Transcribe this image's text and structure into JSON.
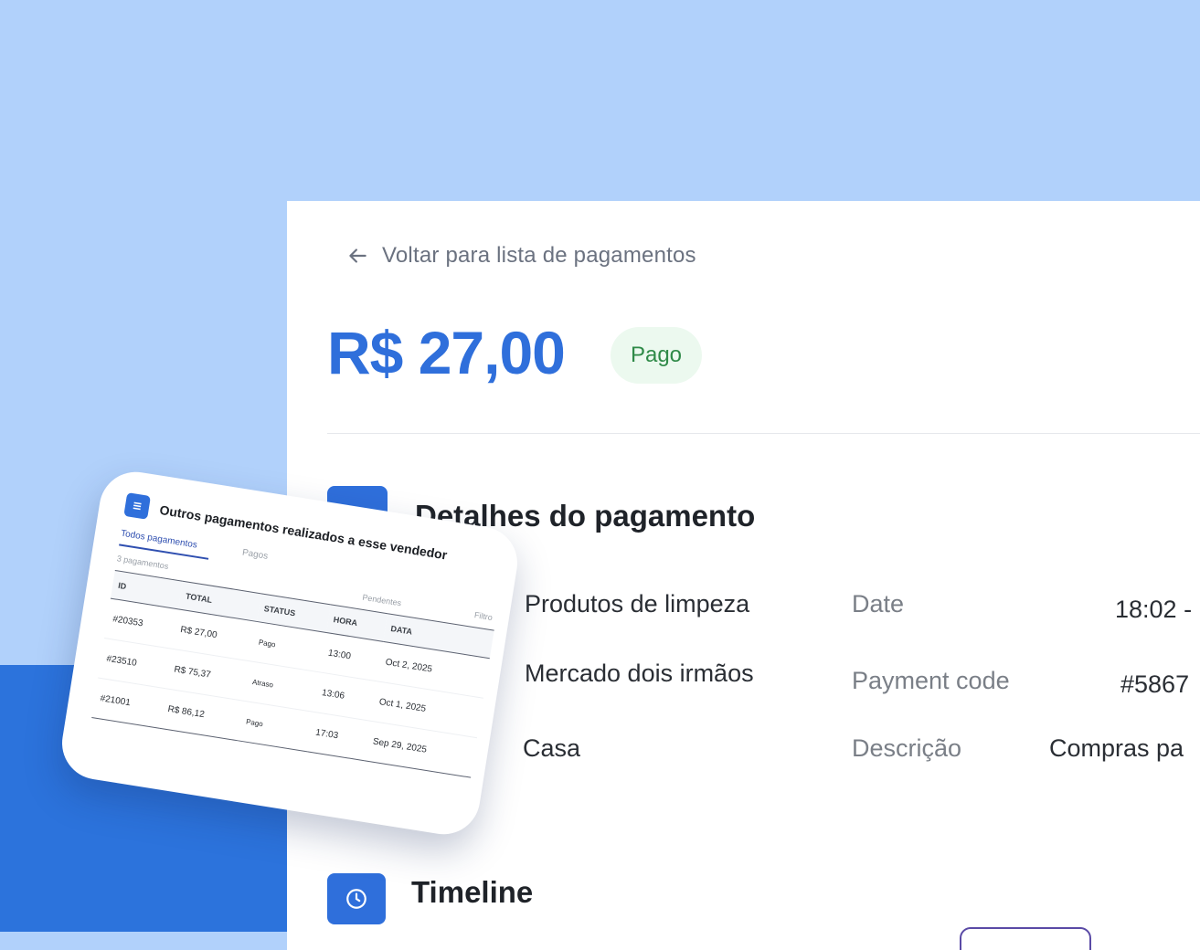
{
  "detail": {
    "back_label": "Voltar para lista de pagamentos",
    "amount": "R$ 27,00",
    "status_badge": "Pago",
    "section_title": "Detalhes do pagamento",
    "list_items": [
      "Produtos de limpeza",
      "Mercado dois irmãos",
      "Casa"
    ],
    "fields": [
      {
        "label": "Date",
        "value": "18:02 -"
      },
      {
        "label": "Payment code",
        "value": "#5867"
      },
      {
        "label": "Descrição",
        "value": "Compras pa"
      }
    ],
    "timeline_title": "Timeline"
  },
  "card": {
    "title": "Outros pagamentos realizados a esse vendedor",
    "tabs": [
      "Todos pagamentos",
      "Pagos"
    ],
    "sub_left": "3 pagamentos",
    "sub_mid": "Pendentes",
    "sub_right": "Filtro",
    "columns": [
      "ID",
      "TOTAL",
      "STATUS",
      "HORA",
      "DATA"
    ],
    "rows": [
      {
        "id": "#20353",
        "total": "R$ 27,00",
        "status": "Pago",
        "hora": "13:00",
        "data": "Oct 2, 2025"
      },
      {
        "id": "#23510",
        "total": "R$ 75,37",
        "status": "Atraso",
        "hora": "13:06",
        "data": "Oct 1, 2025"
      },
      {
        "id": "#21001",
        "total": "R$ 86,12",
        "status": "Pago",
        "hora": "17:03",
        "data": "Sep 29, 2025"
      }
    ]
  },
  "colors": {
    "background": "#b1d1fb",
    "accent": "#2f6fdb",
    "paid_badge_bg": "#ecf9ef",
    "paid_text": "#2f8a48",
    "late_text": "#d38a16"
  },
  "icons": [
    "arrow-left-icon",
    "document-icon",
    "clock-icon",
    "list-icon"
  ]
}
